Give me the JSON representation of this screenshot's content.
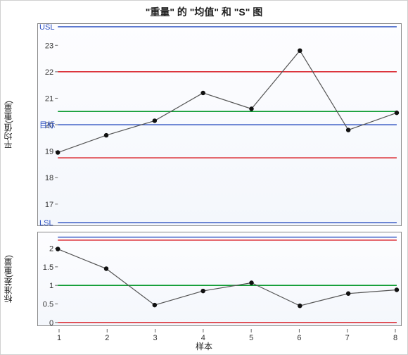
{
  "title": "\"重量\" 的 \"均值\" 和 \"S\" 图",
  "xlabel": "样本",
  "panels": {
    "top": {
      "ylabel": "平均值(重量)",
      "lim_labels": {
        "usl": "USL",
        "target": "目标",
        "lsl": "LSL"
      }
    },
    "bot": {
      "ylabel": "标准差(重量)"
    }
  },
  "chart_data": [
    {
      "type": "line",
      "name": "mean-chart",
      "x": [
        1,
        2,
        3,
        4,
        5,
        6,
        7,
        8
      ],
      "values": [
        18.95,
        19.6,
        20.15,
        21.2,
        20.6,
        22.8,
        19.8,
        20.45
      ],
      "ylim": [
        16.3,
        23.7
      ],
      "yticks": [
        17,
        18,
        19,
        20,
        21,
        22,
        23
      ],
      "ref_lines": {
        "usl": 23.7,
        "ucl_red": 22.0,
        "target_green": 20.5,
        "center_blue": 20.0,
        "lcl_red": 18.75,
        "lsl": 16.3
      }
    },
    {
      "type": "line",
      "name": "s-chart",
      "x": [
        1,
        2,
        3,
        4,
        5,
        6,
        7,
        8
      ],
      "values": [
        1.98,
        1.45,
        0.47,
        0.85,
        1.07,
        0.45,
        0.78,
        0.88
      ],
      "ylim": [
        0,
        2.35
      ],
      "yticks": [
        0,
        0.5,
        1.0,
        1.5,
        2.0
      ],
      "ref_lines": {
        "ucl_blue": 2.3,
        "ucl_red": 2.22,
        "center_green": 1.0,
        "lcl_red": 0.0
      }
    }
  ]
}
